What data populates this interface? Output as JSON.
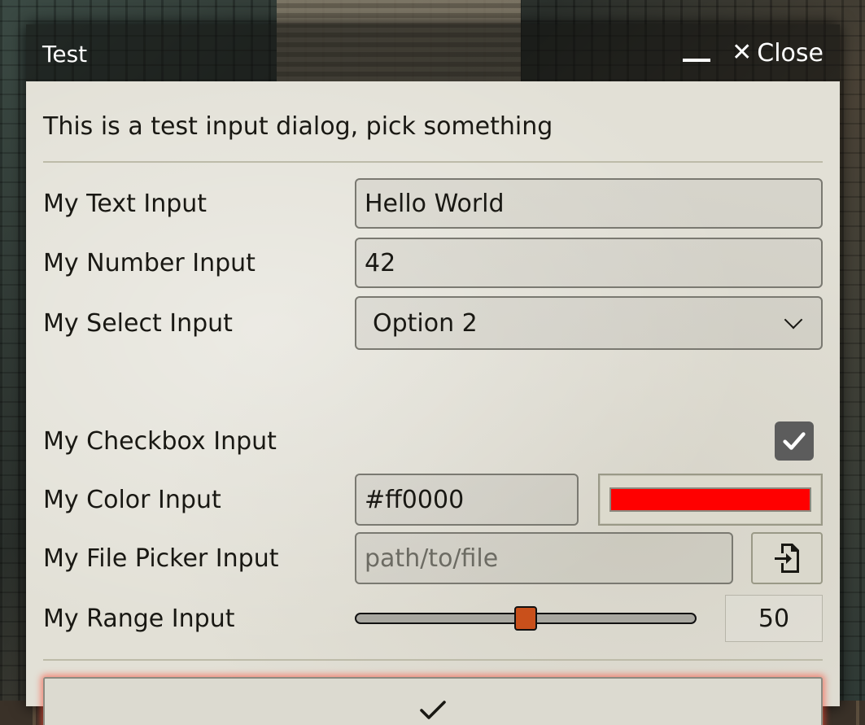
{
  "dialog": {
    "title": "Test",
    "close_label": "Close",
    "description": "This is a test input dialog, pick something"
  },
  "fields": {
    "text": {
      "label": "My Text Input",
      "value": "Hello World"
    },
    "number": {
      "label": "My Number Input",
      "value": "42"
    },
    "select": {
      "label": "My Select Input",
      "selected": "Option 2"
    },
    "checkbox": {
      "label": "My Checkbox Input",
      "checked": true
    },
    "color": {
      "label": "My Color Input",
      "value": "#ff0000",
      "swatch": "#ff0000"
    },
    "file": {
      "label": "My File Picker Input",
      "placeholder": "path/to/file"
    },
    "range": {
      "label": "My Range Input",
      "value": "50",
      "fraction": 0.5
    }
  },
  "icons": {
    "minimize": "minimize-icon",
    "close": "close-icon",
    "select_arrow": "chevron-down-icon",
    "checkbox": "check-icon",
    "file_picker": "file-import-icon",
    "submit": "check-icon"
  },
  "colors": {
    "accent": "#c9501b",
    "submit_glow": "#ff4632",
    "checkbox_bg": "#5c5c5c"
  }
}
